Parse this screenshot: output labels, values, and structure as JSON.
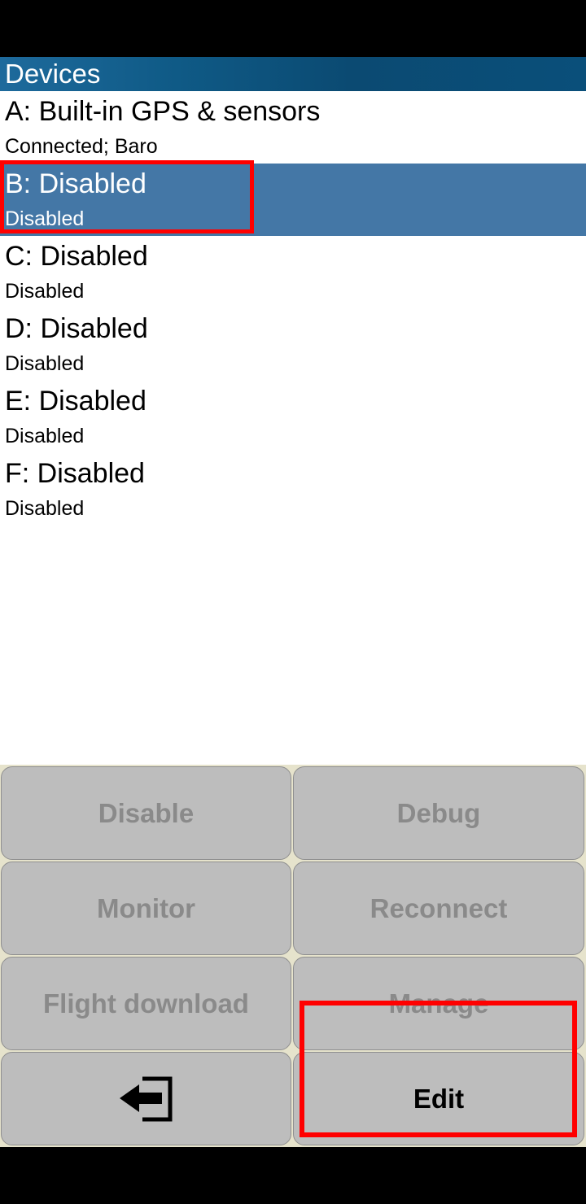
{
  "header": {
    "title": "Devices"
  },
  "devices": [
    {
      "name": "A: Built-in GPS & sensors",
      "status": "Connected; Baro"
    },
    {
      "name": "B: Disabled",
      "status": "Disabled"
    },
    {
      "name": "C: Disabled",
      "status": "Disabled"
    },
    {
      "name": "D: Disabled",
      "status": "Disabled"
    },
    {
      "name": "E: Disabled",
      "status": "Disabled"
    },
    {
      "name": "F: Disabled",
      "status": "Disabled"
    }
  ],
  "selected_device": "B",
  "buttons": {
    "disable": "Disable",
    "debug": "Debug",
    "monitor": "Monitor",
    "reconnect": "Reconnect",
    "flight_download": "Flight download",
    "manage": "Manage",
    "back_icon": "back-arrow-icon",
    "edit": "Edit"
  },
  "colors": {
    "selected_row": "#4477a6",
    "title_bar": "#0f5a86",
    "button_bg": "#bdbdbd",
    "panel_bg": "#e6e3cc",
    "highlight": "#ff0000"
  }
}
